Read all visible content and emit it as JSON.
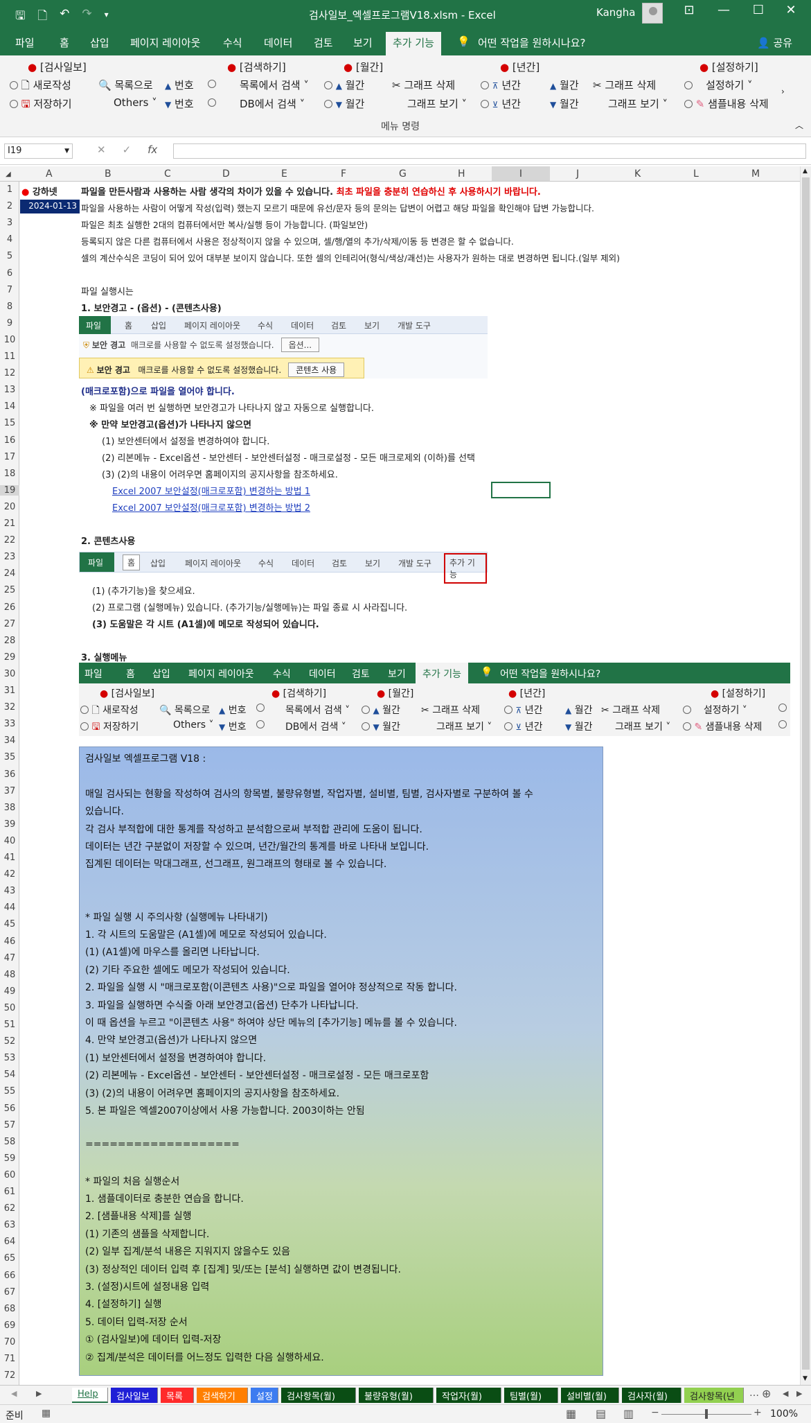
{
  "titlebar": {
    "title": "검사일보_엑셀프로그램V18.xlsm  -  Excel",
    "user": "Kangha",
    "qat": [
      "save-icon",
      "print-preview-icon",
      "undo-icon",
      "redo-icon",
      "customize-icon"
    ]
  },
  "tabs": [
    "파일",
    "홈",
    "삽입",
    "페이지 레이아웃",
    "수식",
    "데이터",
    "검토",
    "보기",
    "추가 기능"
  ],
  "tell_me": "어떤 작업을 원하시나요?",
  "share": "공유",
  "ribbon": {
    "g1_title": "[검사일보]",
    "new": "새로작성",
    "list": "목록으로",
    "num": "번호",
    "save": "저장하기",
    "others": "Others",
    "num2": "번호",
    "g2_title": "[검색하기]",
    "search_list": "목록에서 검색",
    "search_db": "DB에서 검색",
    "g3_title": "[월간]",
    "monthly": "월간",
    "graph_del": "그래프 삭제",
    "monthly2": "월간",
    "graph_view": "그래프 보기",
    "g4_title": "[년간]",
    "yearly": "년간",
    "month_a": "월간",
    "graph_del2": "그래프 삭제",
    "yearly2": "년간",
    "month_b": "월간",
    "graph_view2": "그래프 보기",
    "g5_title": "[설정하기]",
    "setup": "설정하기",
    "sample_del": "샘플내용 삭제",
    "group_label": "메뉴 명령"
  },
  "formula": {
    "namebox": "I19",
    "value": ""
  },
  "columns": [
    "A",
    "B",
    "C",
    "D",
    "E",
    "F",
    "G",
    "H",
    "I",
    "J",
    "K",
    "L",
    "M"
  ],
  "cells": {
    "logo": "강하넷",
    "date": "2024-01-13",
    "r1a": "파일을 만든사람과 사용하는 사람 생각의 차이가 있을 수 있습니다.",
    "r1b": "최초 파일을 충분히 연습하신 후 사용하시기 바랍니다.",
    "r2": "파일을 사용하는 사람이 어떻게 작성(입력) 했는지 모르기 때문에 유선/문자 등의 문의는 답변이 어렵고 해당 파일을 확인해야 답변 가능합니다.",
    "r3": "파일은 최초 실행한 2대의 컴퓨터에서만 복사/실행 등이 가능합니다.  (파일보안)",
    "r4": "등록되지 않은 다른 컴퓨터에서 사용은 정상적이지 않을 수 있으며, 셀/행/열의 추가/삭제/이동 등 변경은 할 수 없습니다.",
    "r5": "셀의 계산수식은 코딩이 되어 있어 대부분 보이지 않습니다. 또한 셀의 인테리어(형식/색상/괘선)는 사용자가 원하는 대로 변경하면 됩니다.(일부 제외)",
    "r7": "파일 실행시는",
    "r8": "1. 보안경고 - (옵션) - (콘텐츠사용)",
    "r13": "(매크로포함)으로 파일을 열어야 합니다.",
    "r14": "※ 파일을 여러 번 실행하면 보안경고가 나타나지 않고 자동으로 실행합니다.",
    "r15": "※ 만약 보안경고(옵션)가 나타나지 않으면",
    "r16": "(1) 보안센터에서 설정을 변경하여야 합니다.",
    "r17": "(2) 리본메뉴 - Excel옵션 - 보안센터 - 보안센터설정 - 매크로설정 - 모든 매크로제외 (이하)를 선택",
    "r18": "(3) (2)의 내용이 어려우면 홈페이지의 공지사항을 참조하세요.",
    "r19": "Excel 2007 보안설정(매크로포함) 변경하는 방법 1",
    "r20": "Excel 2007 보안설정(매크로포함) 변경하는 방법 2",
    "r22": "2. 콘텐츠사용",
    "r25": "(1) (추가기능)을 찾으세요.",
    "r26": "(2) 프로그램 (실행메뉴) 있습니다. (추가기능/실행메뉴)는 파일 종료 시 사라집니다.",
    "r27": "(3) 도움말은 각 시트 (A1셀)에 메모로 작성되어 있습니다.",
    "r29": "3. 실행메뉴"
  },
  "shot1": {
    "tabs": [
      "파일",
      "홈",
      "삽입",
      "페이지 레이아웃",
      "수식",
      "데이터",
      "검토",
      "보기",
      "개발 도구"
    ],
    "warn_small": "보안 경고",
    "warn_small_text": "매크로를 사용할 수 없도록 설정했습니다.",
    "option_btn": "옵션...",
    "warn_big": "보안 경고",
    "warn_big_text": "매크로를 사용할 수 없도록 설정했습니다.",
    "content_btn": "콘텐츠 사용"
  },
  "shot2": {
    "tabs": [
      "파일",
      "홈",
      "삽입",
      "페이지 레이아웃",
      "수식",
      "데이터",
      "검토",
      "보기",
      "개발 도구",
      "추가 기능"
    ]
  },
  "infobox": [
    "검사일보 엑셀프로그램 V18 :",
    "",
    "매일 검사되는 현황을 작성하여 검사의 항목별, 불량유형별, 작업자별, 설비별, 팀별, 검사자별로 구분하여 볼 수",
    "있습니다.",
    "각 검사 부적합에 대한 통계를 작성하고 분석함으로써 부적합 관리에 도움이 됩니다.",
    "데이터는 년간 구분없이 저장할 수 있으며, 년간/월간의 통계를 바로 나타내 보입니다.",
    "집계된 데이터는 막대그래프, 선그래프, 원그래프의 형태로 볼 수 있습니다.",
    "",
    "",
    "* 파일 실행 시 주의사항 (실행메뉴 나타내기)",
    "1. 각 시트의 도움말은 (A1셀)에 메모로 작성되어 있습니다.",
    "  (1) (A1셀)에 마우스를 올리면 나타납니다.",
    "  (2) 기타 주요한 셀에도 메모가 작성되어 있습니다.",
    "2. 파일을 실행 시 \"매크로포함(이콘텐츠 사용)\"으로 파일을 열어야 정상적으로 작동 합니다.",
    "3. 파일을 실행하면 수식줄 아래 보안경고(옵션) 단추가 나타납니다.",
    "   이 때 옵션을 누르고 \"이콘텐츠 사용\" 하여야 상단 메뉴의 [추가기능] 메뉴를 볼 수 있습니다.",
    "4. 만약 보안경고(옵션)가 나타나지 않으면",
    "  (1) 보안센터에서 설정을 변경하여야 합니다.",
    "  (2) 리본메뉴 - Excel옵션 - 보안센터 - 보안센터설정 - 매크로설정 - 모든 매크로포함",
    "  (3) (2)의 내용이 어려우면 홈페이지의 공지사항을 참조하세요.",
    "5. 본 파일은 엑셀2007이상에서 사용 가능합니다. 2003이하는 안됨",
    "",
    "===================",
    "",
    "* 파일의 처음 실행순서",
    "1. 샘플데이터로 충분한 연습을 합니다.",
    "2. [샘플내용 삭제]를 실행",
    "  (1) 기존의 샘플을 삭제합니다.",
    "  (2) 일부 집계/분석 내용은 지워지지 않을수도 있음",
    "  (3) 정상적인 데이터 입력 후 [집계] 및/또는 [분석] 실행하면 값이 변경됩니다.",
    "3. (설정)시트에 설정내용 입력",
    "4. [설정하기] 실행",
    "5. 데이터 입력-저장 순서",
    "  ① (검사일보)에 데이터 입력-저장",
    "  ② 집계/분석은 데이터를 어느정도 입력한 다음 실행하세요."
  ],
  "sheets": [
    {
      "name": "Help",
      "bg": "#ffffff",
      "fg": "#217346"
    },
    {
      "name": "검사일보",
      "bg": "#1f1fd6",
      "fg": "#ffffff"
    },
    {
      "name": "목록",
      "bg": "#ff2a2a",
      "fg": "#ffffff"
    },
    {
      "name": "검색하기",
      "bg": "#ff7f00",
      "fg": "#ffffff"
    },
    {
      "name": "설정",
      "bg": "#3d7cf0",
      "fg": "#ffffff"
    },
    {
      "name": "검사항목(월)",
      "bg": "#0a4d14",
      "fg": "#ffffff"
    },
    {
      "name": "불량유형(월)",
      "bg": "#0a4d14",
      "fg": "#ffffff"
    },
    {
      "name": "작업자(월)",
      "bg": "#0a4d14",
      "fg": "#ffffff"
    },
    {
      "name": "팀별(월)",
      "bg": "#0a4d14",
      "fg": "#ffffff"
    },
    {
      "name": "설비별(월)",
      "bg": "#0a4d14",
      "fg": "#ffffff"
    },
    {
      "name": "검사자(월)",
      "bg": "#0a4d14",
      "fg": "#ffffff"
    },
    {
      "name": "검사항목(년",
      "bg": "#92d050",
      "fg": "#222222"
    }
  ],
  "status": {
    "ready": "준비",
    "zoom": "100%"
  },
  "colors": {
    "excel_green": "#217346",
    "warn_red": "#e00000",
    "link_blue": "#1f3fbf"
  }
}
